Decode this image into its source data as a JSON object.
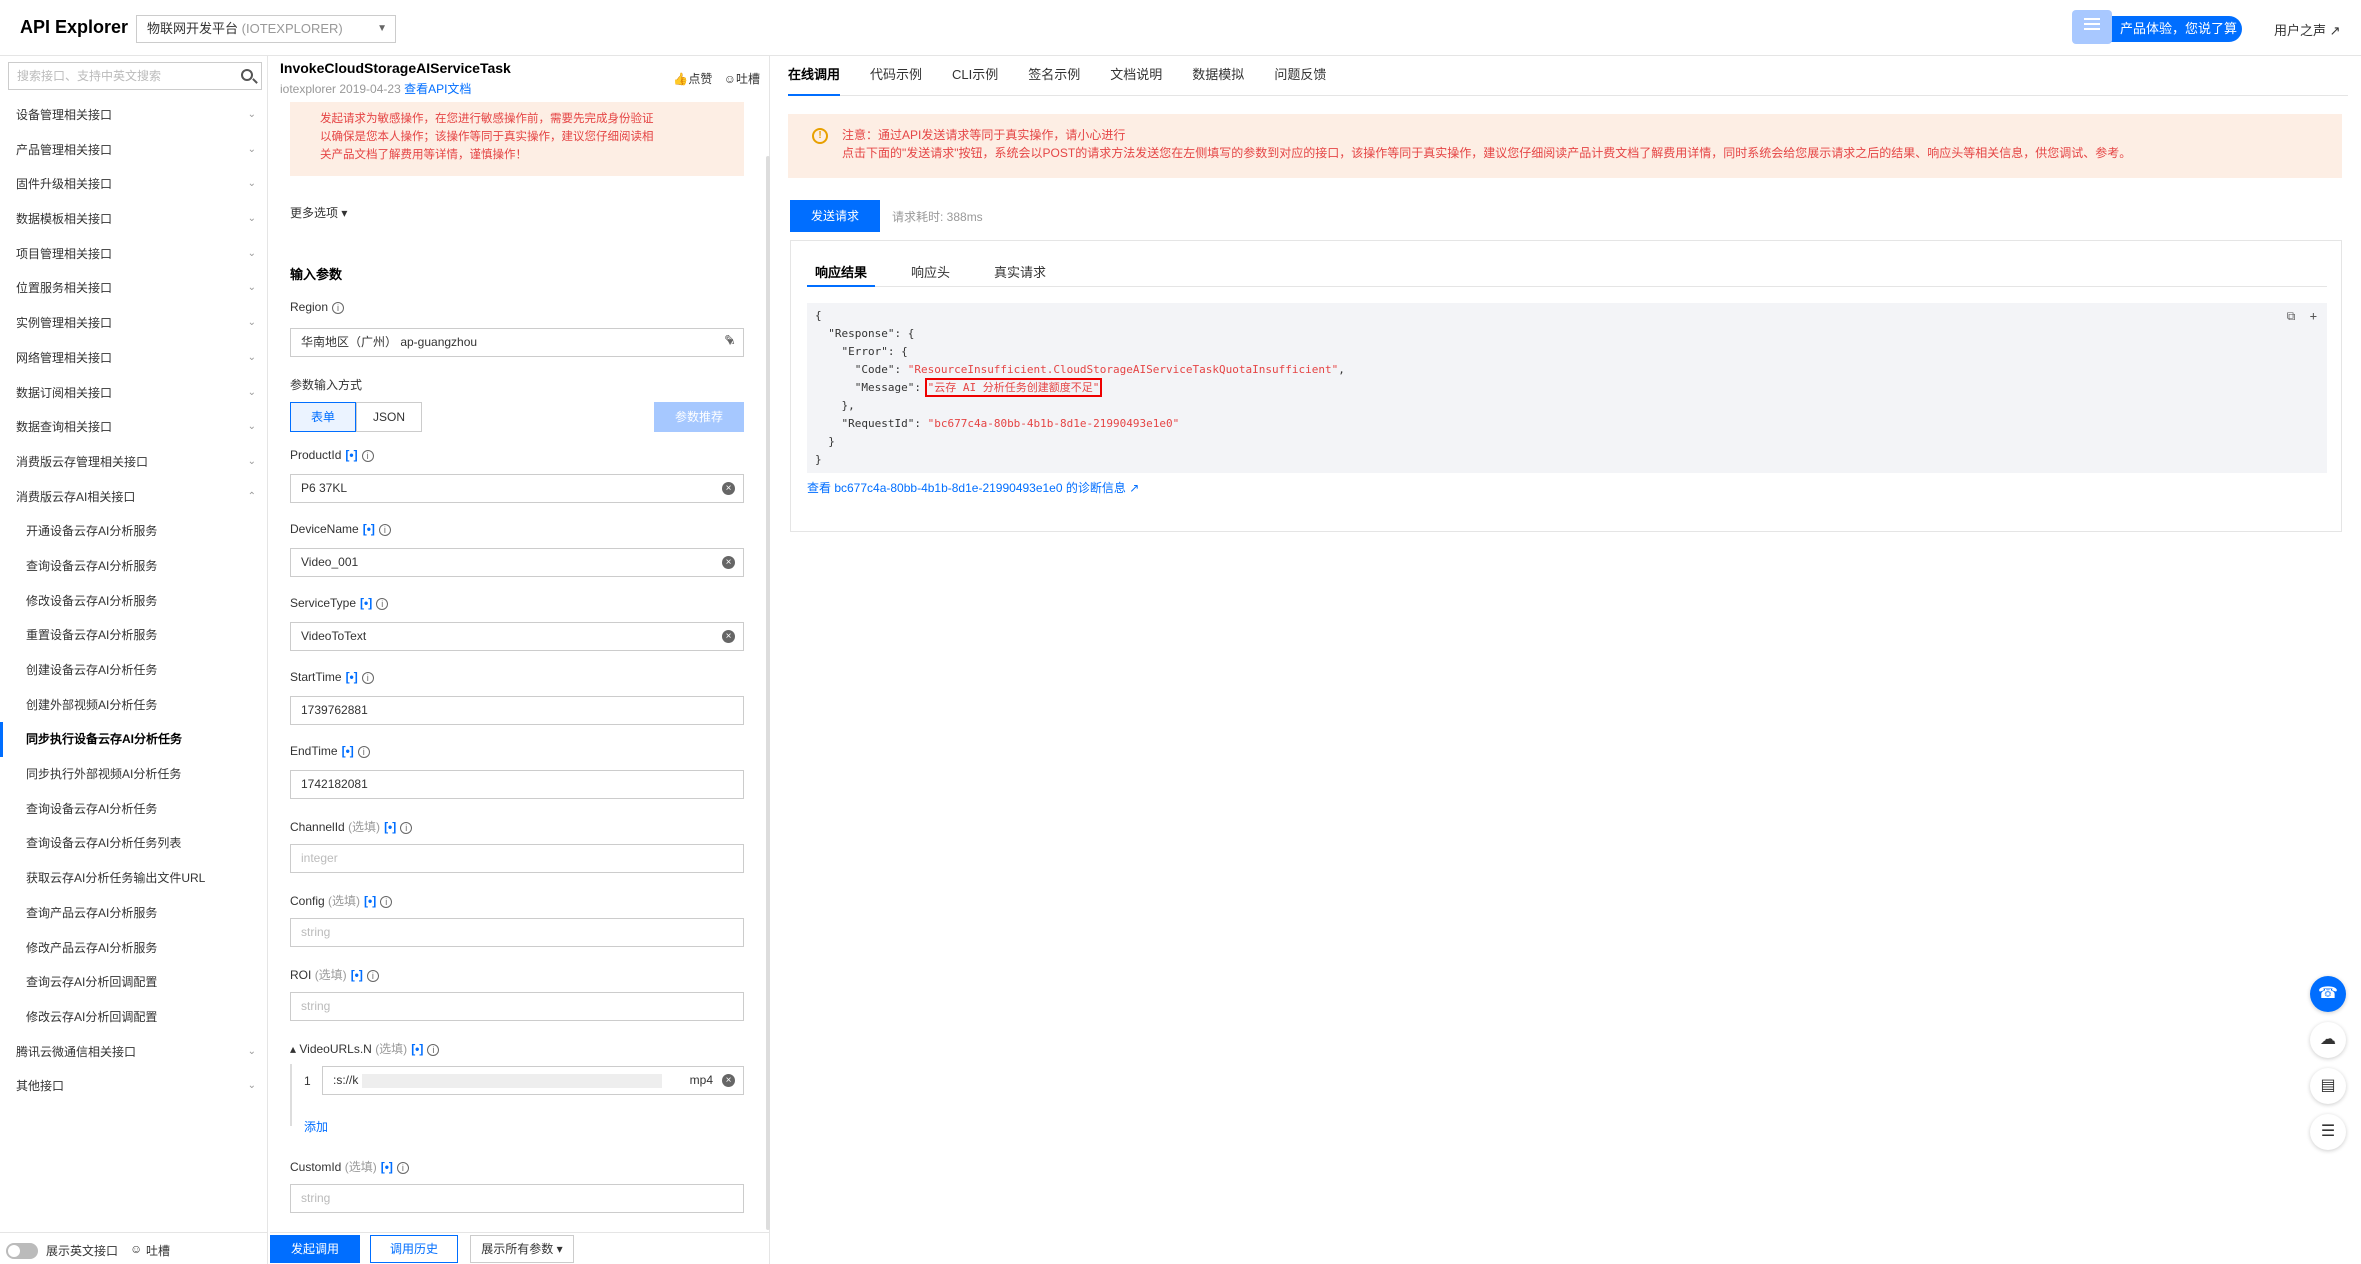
{
  "topbar": {
    "brand": "API Explorer",
    "product_name": "物联网开发平台",
    "product_code": "(IOTEXPLORER)",
    "promo": "产品体验，您说了算",
    "voice": "用户之声"
  },
  "sidebar": {
    "search_placeholder": "搜索接口、支持中英文搜索",
    "items": [
      "设备管理相关接口",
      "产品管理相关接口",
      "固件升级相关接口",
      "数据模板相关接口",
      "项目管理相关接口",
      "位置服务相关接口",
      "实例管理相关接口",
      "网络管理相关接口",
      "数据订阅相关接口",
      "数据查询相关接口",
      "消费版云存管理相关接口",
      "消费版云存AI相关接口"
    ],
    "sub_items": [
      "开通设备云存AI分析服务",
      "查询设备云存AI分析服务",
      "修改设备云存AI分析服务",
      "重置设备云存AI分析服务",
      "创建设备云存AI分析任务",
      "创建外部视频AI分析任务",
      "同步执行设备云存AI分析任务",
      "同步执行外部视频AI分析任务",
      "查询设备云存AI分析任务",
      "查询设备云存AI分析任务列表",
      "获取云存AI分析任务输出文件URL",
      "查询产品云存AI分析服务",
      "修改产品云存AI分析服务",
      "查询云存AI分析回调配置",
      "修改云存AI分析回调配置"
    ],
    "tail_items": [
      "腾讯云微通信相关接口",
      "其他接口"
    ],
    "show_english": "展示英文接口",
    "feedback": "吐槽"
  },
  "middle": {
    "api_name": "InvokeCloudStorageAIServiceTask",
    "meta": "iotexplorer 2019-04-23",
    "doc_link": "查看API文档",
    "like": "点赞",
    "complain": "吐槽",
    "warning_l1": "发起请求为敏感操作，在您进行敏感操作前，需要先完成身份验证",
    "warning_l2": "以确保是您本人操作；该操作等同于真实操作，建议您仔细阅读相",
    "warning_l3": "关产品文档了解费用等详情，谨慎操作！",
    "more_options": "更多选项",
    "input_params": "输入参数",
    "region_label": "Region",
    "region_value": "华南地区（广州） ap-guangzhou",
    "input_mode_label": "参数输入方式",
    "mode_form": "表单",
    "mode_json": "JSON",
    "recommend": "参数推荐",
    "productid_label": "ProductId",
    "productid_value": "P6      37KL",
    "devicename_label": "DeviceName",
    "devicename_value": "Video_001",
    "servicetype_label": "ServiceType",
    "servicetype_value": "VideoToText",
    "starttime_label": "StartTime",
    "starttime_value": "1739762881",
    "endtime_label": "EndTime",
    "endtime_value": "1742182081",
    "channelid_label": "ChannelId",
    "config_label": "Config",
    "roi_label": "ROI",
    "videourls_label": "VideoURLs.N",
    "customid_label": "CustomId",
    "optional": "(选填)",
    "tag": "[•]",
    "ph_integer": "integer",
    "ph_string": "string",
    "video_index": "1",
    "video_url_start": ":s://k",
    "video_url_end": "mp4",
    "add": "添加",
    "submit": "发起调用",
    "history": "调用历史",
    "show_all": "展示所有参数"
  },
  "right": {
    "tabs": [
      "在线调用",
      "代码示例",
      "CLI示例",
      "签名示例",
      "文档说明",
      "数据模拟",
      "问题反馈"
    ],
    "notice_l1": "注意：通过API发送请求等同于真实操作，请小心进行",
    "notice_l2": "点击下面的\"发送请求\"按钮，系统会以POST的请求方法发送您在左侧填写的参数到对应的接口，该操作等同于真实操作，建议您仔细阅读产品计费文档了解费用详情，同时系统会给您展示请求之后的结果、响应头等相关信息，供您调试、参考。",
    "send": "发送请求",
    "cost": "请求耗时: 388ms",
    "resp_tabs": [
      "响应结果",
      "响应头",
      "真实请求"
    ],
    "code": {
      "l1": "{",
      "l2": "  \"Response\": {",
      "l3": "    \"Error\": {",
      "l4_key": "      \"Code\": ",
      "l4_val": "\"ResourceInsufficient.CloudStorageAIServiceTaskQuotaInsufficient\"",
      "l5_key": "      \"Message\": ",
      "l5_val": "\"云存 AI 分析任务创建额度不足\"",
      "l6": "    },",
      "l7_key": "    \"RequestId\": ",
      "l7_val": "\"bc677c4a-80bb-4b1b-8d1e-21990493e1e0\"",
      "l8": "  }",
      "l9": "}"
    },
    "diag_link": "查看 bc677c4a-80bb-4b1b-8d1e-21990493e1e0 的诊断信息"
  }
}
